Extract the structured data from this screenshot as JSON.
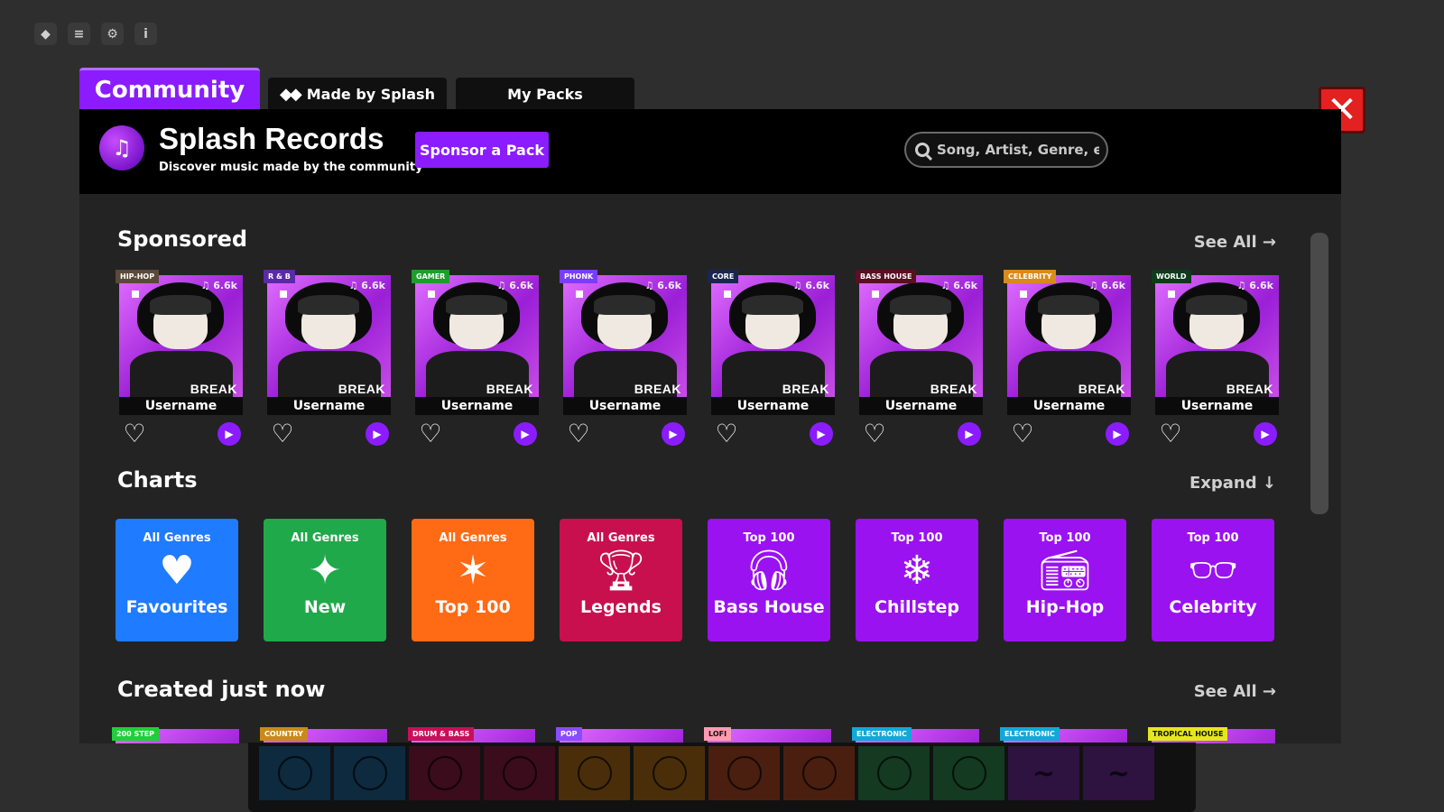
{
  "tabs": {
    "community": "Community",
    "made_by_splash": "Made by Splash",
    "my_packs": "My Packs"
  },
  "close_label": "✕",
  "header": {
    "title": "Splash Records",
    "subtitle": "Discover music made by the community",
    "sponsor_button": "Sponsor a Pack",
    "search_placeholder": "Song, Artist, Genre, etc."
  },
  "sponsored": {
    "title": "Sponsored",
    "see_all": "See All",
    "cards": [
      {
        "genre": "HIP-HOP",
        "genre_color": "#5b4a3a",
        "cover_text": "BREAK",
        "count": "6.6k",
        "username": "Username"
      },
      {
        "genre": "R & B",
        "genre_color": "#5a2aa8",
        "cover_text": "BREAK",
        "count": "6.6k",
        "username": "Username"
      },
      {
        "genre": "GAMER",
        "genre_color": "#1c9e2c",
        "cover_text": "BREAK",
        "count": "6.6k",
        "username": "Username"
      },
      {
        "genre": "PHONK",
        "genre_color": "#7a3cff",
        "cover_text": "BREAK",
        "count": "6.6k",
        "username": "Username"
      },
      {
        "genre": "CORE",
        "genre_color": "#1a2650",
        "cover_text": "BREAK",
        "count": "6.6k",
        "username": "Username"
      },
      {
        "genre": "BASS HOUSE",
        "genre_color": "#5a0f25",
        "cover_text": "BREAK",
        "count": "6.6k",
        "username": "Username"
      },
      {
        "genre": "CELEBRITY",
        "genre_color": "#d98a1a",
        "cover_text": "BREAK",
        "count": "6.6k",
        "username": "Username"
      },
      {
        "genre": "WORLD",
        "genre_color": "#0f3a1c",
        "cover_text": "BREAK",
        "count": "6.6k",
        "username": "Username"
      }
    ]
  },
  "charts": {
    "title": "Charts",
    "expand": "Expand",
    "tiles": [
      {
        "top": "All Genres",
        "name": "Favourites",
        "icon": "heart-icon",
        "glyph": "♥",
        "color": "#1f7bff"
      },
      {
        "top": "All Genres",
        "name": "New",
        "icon": "sparkles-icon",
        "glyph": "✦",
        "color": "#20a94a"
      },
      {
        "top": "All Genres",
        "name": "Top 100",
        "icon": "star-icon",
        "glyph": "✶",
        "color": "#ff6a14"
      },
      {
        "top": "All Genres",
        "name": "Legends",
        "icon": "trophy-icon",
        "glyph": "🏆︎",
        "color": "#c8104e"
      },
      {
        "top": "Top 100",
        "name": "Bass House",
        "icon": "headphones-icon",
        "glyph": "🎧︎",
        "color": "#9a12f0"
      },
      {
        "top": "Top 100",
        "name": "Chillstep",
        "icon": "snowflake-icon",
        "glyph": "❄",
        "color": "#9a12f0"
      },
      {
        "top": "Top 100",
        "name": "Hip-Hop",
        "icon": "boombox-icon",
        "glyph": "📻︎",
        "color": "#9a12f0"
      },
      {
        "top": "Top 100",
        "name": "Celebrity",
        "icon": "sunglasses-icon",
        "glyph": "👓︎",
        "color": "#9a12f0"
      }
    ]
  },
  "created": {
    "title": "Created just now",
    "see_all": "See All",
    "tags": [
      {
        "genre": "200 STEP",
        "color": "#1ecf3a"
      },
      {
        "genre": "COUNTRY",
        "color": "#c98a1a"
      },
      {
        "genre": "DRUM & BASS",
        "color": "#c8105a"
      },
      {
        "genre": "POP",
        "color": "#8a4cff"
      },
      {
        "genre": "LOFI",
        "color": "#ff9ab0"
      },
      {
        "genre": "ELECTRONIC",
        "color": "#12a8d8"
      },
      {
        "genre": "ELECTRONIC",
        "color": "#12a8d8"
      },
      {
        "genre": "TROPICAL HOUSE",
        "color": "#e6e61e"
      }
    ]
  },
  "pads": [
    {
      "color": "#0d2a3f",
      "shape": "ring"
    },
    {
      "color": "#0d2a3f",
      "shape": "ring"
    },
    {
      "color": "#3a0c1c",
      "shape": "ring"
    },
    {
      "color": "#3a0c1c",
      "shape": "ring"
    },
    {
      "color": "#4a2e0a",
      "shape": "ring"
    },
    {
      "color": "#4a2e0a",
      "shape": "ring"
    },
    {
      "color": "#4a1f10",
      "shape": "ring"
    },
    {
      "color": "#4a1f10",
      "shape": "ring"
    },
    {
      "color": "#143a22",
      "shape": "ring"
    },
    {
      "color": "#143a22",
      "shape": "ring"
    },
    {
      "color": "#2e1240",
      "shape": "wave"
    },
    {
      "color": "#2e1240",
      "shape": "wave"
    }
  ]
}
